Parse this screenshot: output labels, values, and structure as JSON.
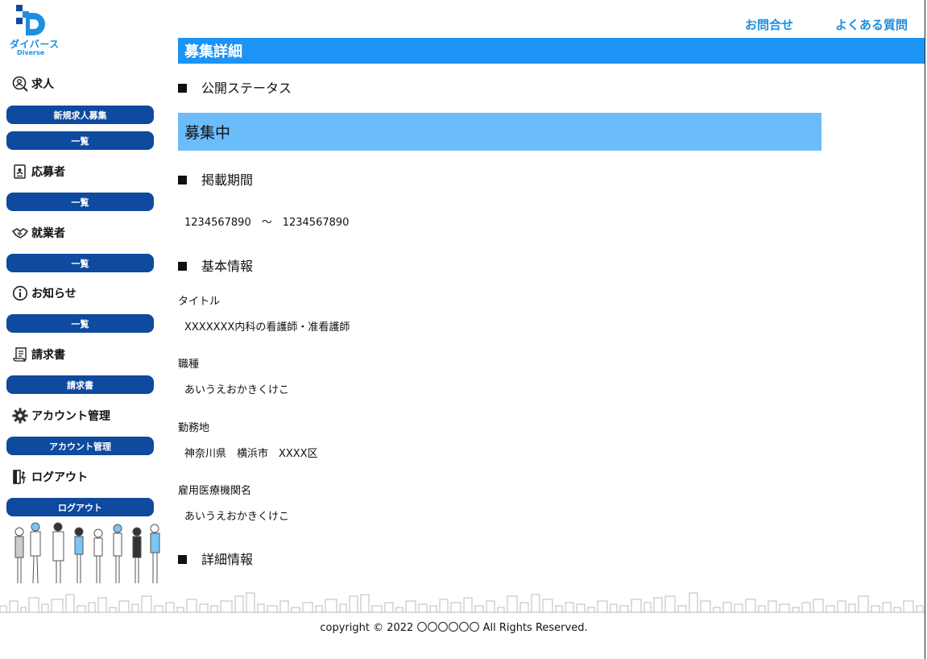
{
  "brand": {
    "name": "ダイバース",
    "sub": "Diverse"
  },
  "header": {
    "nav": [
      "お問合せ",
      "よくある質問"
    ]
  },
  "sidebar": {
    "sections": [
      {
        "label": "求人",
        "icon": "search-person-icon",
        "buttons": [
          "新規求人募集",
          "一覧"
        ]
      },
      {
        "label": "応募者",
        "icon": "document-person-icon",
        "buttons": [
          "一覧"
        ]
      },
      {
        "label": "就業者",
        "icon": "handshake-icon",
        "buttons": [
          "一覧"
        ]
      },
      {
        "label": "お知らせ",
        "icon": "info-icon",
        "buttons": [
          "一覧"
        ]
      },
      {
        "label": "請求書",
        "icon": "receipt-icon",
        "buttons": [
          "請求書"
        ]
      },
      {
        "label": "アカウント管理",
        "icon": "gear-icon",
        "buttons": [
          "アカウント管理"
        ]
      },
      {
        "label": "ログアウト",
        "icon": "logout-icon",
        "buttons": [
          "ログアウト"
        ]
      }
    ]
  },
  "main": {
    "title": "募集詳細",
    "public_status": {
      "heading": "公開ステータス",
      "value": "募集中"
    },
    "period": {
      "heading": "掲載期間",
      "value": "1234567890　～　1234567890"
    },
    "basic": {
      "heading": "基本情報",
      "fields": [
        {
          "label": "タイトル",
          "value": "XXXXXXX内科の看護師・准看護師"
        },
        {
          "label": "職種",
          "value": "あいうえおかきくけこ"
        },
        {
          "label": "勤務地",
          "value": "神奈川県　横浜市　XXXX区"
        },
        {
          "label": "雇用医療機関名",
          "value": "あいうえおかきくけこ"
        }
      ]
    },
    "detail": {
      "heading": "詳細情報"
    }
  },
  "footer": {
    "copyright": "copyright © 2022 〇〇〇〇〇〇 All Rights Reserved."
  },
  "colors": {
    "title_bar": "#1c94f5",
    "status_bar": "#6bbcfb",
    "pill": "#0e4a9e",
    "link": "#1e8fe0"
  }
}
